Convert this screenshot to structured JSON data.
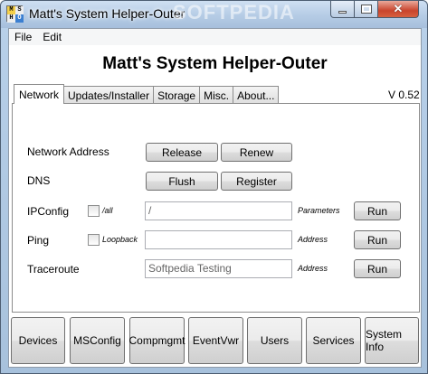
{
  "window": {
    "title": "Matt's System Helper-Outer",
    "watermark": "SOFTPEDIA",
    "icon_letters": [
      "M",
      "S",
      "H",
      "O"
    ]
  },
  "menu": {
    "items": [
      "File",
      "Edit"
    ]
  },
  "app_title": "Matt's System Helper-Outer",
  "tabs": [
    "Network",
    "Updates/Installer",
    "Storage",
    "Misc.",
    "About..."
  ],
  "active_tab": "Network",
  "version": "V 0.52",
  "network": {
    "address": {
      "label": "Network Address",
      "release": "Release",
      "renew": "Renew"
    },
    "dns": {
      "label": "DNS",
      "flush": "Flush",
      "register": "Register"
    },
    "ipconfig": {
      "label": "IPConfig",
      "checkbox_label": "/all",
      "value": "/",
      "field_label": "Parameters",
      "run": "Run"
    },
    "ping": {
      "label": "Ping",
      "checkbox_label": "Loopback",
      "value": "",
      "field_label": "Address",
      "run": "Run"
    },
    "traceroute": {
      "label": "Traceroute",
      "value": "Softpedia Testing",
      "field_label": "Address",
      "run": "Run"
    }
  },
  "bottom_buttons": [
    "Devices",
    "MSConfig",
    "Compmgmt",
    "EventVwr",
    "Users",
    "Services",
    "System Info"
  ],
  "colors": {
    "close_button": "#c9442c",
    "titlebar": "#b7cde6"
  }
}
